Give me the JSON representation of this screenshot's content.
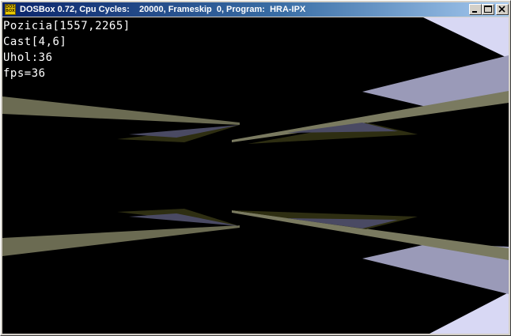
{
  "window": {
    "title": "DOSBox 0.72, Cpu Cycles:    20000, Frameskip  0, Program:  HRA-IPX",
    "icon_label": "DOS BOX",
    "icon": "dosbox-icon",
    "buttons": {
      "minimize": "minimize-icon",
      "maximize": "maximize-icon",
      "close": "close-icon"
    }
  },
  "hud": {
    "position": "Pozicia[1557,2265]",
    "part": "Cast[4,6]",
    "angle": "Uhol:36",
    "fps": "fps=36"
  },
  "colors": {
    "title_bar_start": "#0a246a",
    "title_bar_end": "#a6caf0",
    "background": "#000000",
    "wall_olive": "#6b6b52",
    "wall_dark": "#2e2e12",
    "wall_lavender": "#9090b0",
    "wall_light": "#d8d8f4",
    "wall_mid": "#4a4a63"
  }
}
